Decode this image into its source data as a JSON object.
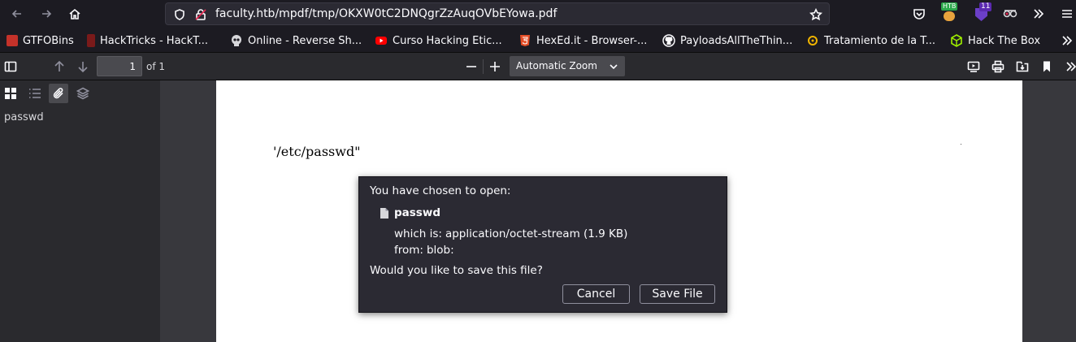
{
  "browser": {
    "url": "faculty.htb/mpdf/tmp/OKXW0tC2DNQgrZzAuqOVbEYowa.pdf",
    "extension_badge_htb": "HTB",
    "extension_badge_count": "11"
  },
  "bookmarks": [
    {
      "label": "GTFOBins",
      "icon": "gtfobins-icon",
      "color": "#c4322a"
    },
    {
      "label": "HackTricks - HackT...",
      "icon": "hacktricks-icon",
      "color": "#7a1a1a"
    },
    {
      "label": "Online - Reverse Sh...",
      "icon": "skull-icon",
      "color": "#d7d7db"
    },
    {
      "label": "Curso Hacking Etic...",
      "icon": "youtube-icon",
      "color": "#ff0000"
    },
    {
      "label": "HexEd.it - Browser-...",
      "icon": "html5-icon",
      "color": "#e44d26"
    },
    {
      "label": "PayloadsAllTheThin...",
      "icon": "github-icon",
      "color": "#fbfbfe"
    },
    {
      "label": "Tratamiento de la T...",
      "icon": "radiation-icon",
      "color": "#f0b400"
    },
    {
      "label": "Hack The Box",
      "icon": "htb-cube-icon",
      "color": "#9fef00"
    }
  ],
  "pdf_toolbar": {
    "page_number": "1",
    "page_count": "of 1",
    "zoom": "Automatic Zoom"
  },
  "sidebar": {
    "attachments": [
      "passwd"
    ]
  },
  "document": {
    "text": "'/etc/passwd\""
  },
  "dialog": {
    "intro": "You have chosen to open:",
    "filename": "passwd",
    "type_label": "which is:",
    "type_value": "application/octet-stream (1.9 KB)",
    "from_label": "from:",
    "from_value": "blob:",
    "question": "Would you like to save this file?",
    "cancel_label": "Cancel",
    "save_label": "Save File"
  }
}
